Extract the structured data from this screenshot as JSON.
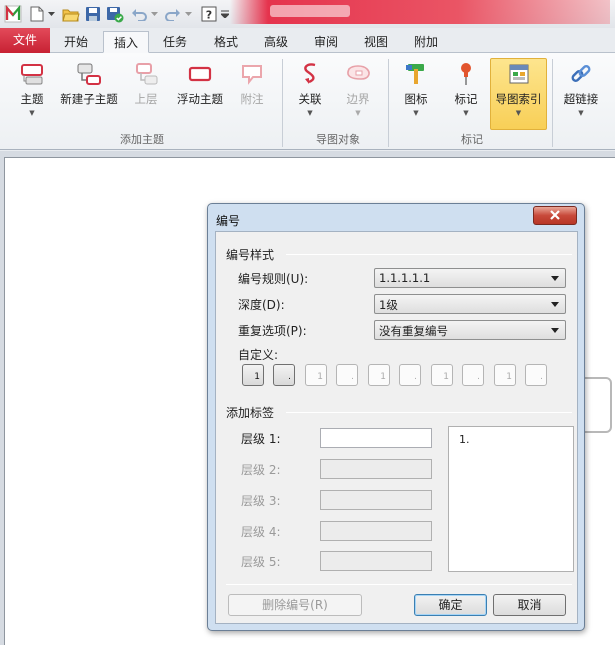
{
  "tabs": {
    "file": "文件",
    "items": [
      "开始",
      "插入",
      "任务",
      "格式",
      "高级",
      "审阅",
      "视图",
      "附加"
    ],
    "active": "插入"
  },
  "ribbon": {
    "add_topic": {
      "label": "添加主题",
      "buttons": [
        "主题",
        "新建子主题",
        "上层",
        "浮动主题",
        "附注"
      ]
    },
    "map_objects": {
      "label": "导图对象",
      "buttons": [
        "关联",
        "边界"
      ]
    },
    "markers": {
      "label": "标记",
      "buttons": [
        "图标",
        "标记",
        "导图索引"
      ]
    },
    "link": {
      "button": "超链接"
    }
  },
  "dialog": {
    "title": "编号",
    "numbering_style": {
      "section": "编号样式",
      "rule_label": "编号规则(U):",
      "rule_value": "1.1.1.1.1",
      "depth_label": "深度(D):",
      "depth_value": "1级",
      "repeat_label": "重复选项(P):",
      "repeat_value": "没有重复编号",
      "custom_label": "自定义:",
      "custom_boxes": [
        "1",
        ".",
        "1",
        ".",
        "1",
        ".",
        "1",
        ".",
        "1",
        "."
      ]
    },
    "add_label": {
      "section": "添加标签",
      "levels": [
        "层级 1:",
        "层级 2:",
        "层级 3:",
        "层级 4:",
        "层级 5:"
      ],
      "preview_text": "1."
    },
    "buttons": {
      "delete": "删除编号(R)",
      "ok": "确定",
      "cancel": "取消"
    }
  },
  "colors": {
    "file_tab": "#d33244",
    "highlight": "#f8cf57",
    "dialog_frame": "#cfdff0",
    "close_button": "#c8493a"
  }
}
